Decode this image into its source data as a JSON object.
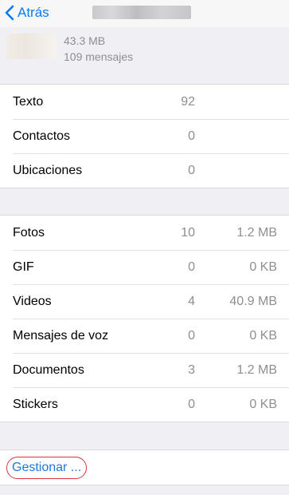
{
  "nav": {
    "back_label": "Atrás"
  },
  "header": {
    "size": "43.3 MB",
    "messages": "109 mensajes"
  },
  "summary_rows": [
    {
      "label": "Texto",
      "count": "92",
      "size": ""
    },
    {
      "label": "Contactos",
      "count": "0",
      "size": ""
    },
    {
      "label": "Ubicaciones",
      "count": "0",
      "size": ""
    }
  ],
  "media_rows": [
    {
      "label": "Fotos",
      "count": "10",
      "size": "1.2 MB"
    },
    {
      "label": "GIF",
      "count": "0",
      "size": "0 KB"
    },
    {
      "label": "Videos",
      "count": "4",
      "size": "40.9 MB"
    },
    {
      "label": "Mensajes de voz",
      "count": "0",
      "size": "0 KB"
    },
    {
      "label": "Documentos",
      "count": "3",
      "size": "1.2 MB"
    },
    {
      "label": "Stickers",
      "count": "0",
      "size": "0 KB"
    }
  ],
  "manage": {
    "label": "Gestionar ..."
  },
  "colors": {
    "accent": "#0a7af5",
    "highlight_ring": "#d9343d",
    "background": "#efeff4"
  }
}
